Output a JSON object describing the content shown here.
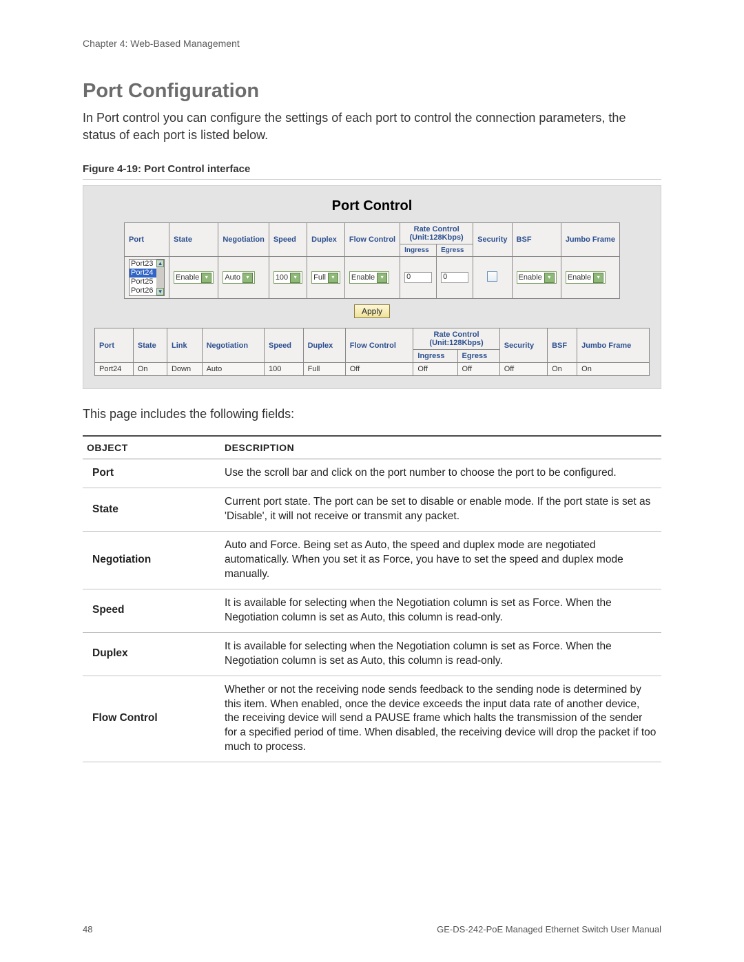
{
  "chapter_label": "Chapter 4: Web-Based Management",
  "section_title": "Port Configuration",
  "section_intro": "In Port control you can configure the settings of each port to control the connection parameters, the status of each port is listed below.",
  "figure_caption": "Figure 4-19:  Port Control interface",
  "panel": {
    "title": "Port Control",
    "control_headers": {
      "port": "Port",
      "state": "State",
      "negotiation": "Negotiation",
      "speed": "Speed",
      "duplex": "Duplex",
      "flow_control": "Flow Control",
      "rate_control_top": "Rate Control",
      "rate_control_unit": "(Unit:128Kbps)",
      "ingress": "Ingress",
      "egress": "Egress",
      "security": "Security",
      "bsf": "BSF",
      "jumbo": "Jumbo Frame"
    },
    "port_list": {
      "items": [
        "Port23",
        "Port24",
        "Port25",
        "Port26"
      ],
      "selected": "Port24"
    },
    "control_row": {
      "state": "Enable",
      "negotiation": "Auto",
      "speed": "100",
      "duplex": "Full",
      "flow_control": "Enable",
      "ingress": "0",
      "egress": "0",
      "security_checked": false,
      "bsf": "Enable",
      "jumbo": "Enable"
    },
    "apply_label": "Apply",
    "status_headers": {
      "port": "Port",
      "state": "State",
      "link": "Link",
      "negotiation": "Negotiation",
      "speed": "Speed",
      "duplex": "Duplex",
      "flow_control": "Flow Control",
      "rate_control_top": "Rate Control",
      "rate_control_unit": "(Unit:128Kbps)",
      "ingress": "Ingress",
      "egress": "Egress",
      "security": "Security",
      "bsf": "BSF",
      "jumbo": "Jumbo Frame"
    },
    "status_row": {
      "port": "Port24",
      "state": "On",
      "link": "Down",
      "negotiation": "Auto",
      "speed": "100",
      "duplex": "Full",
      "flow_control": "Off",
      "ingress": "Off",
      "egress": "Off",
      "security": "Off",
      "bsf": "On",
      "jumbo": "On"
    }
  },
  "post_figure_text": "This page includes the following fields:",
  "fields_table": {
    "head_object": "OBJECT",
    "head_description": "DESCRIPTION",
    "rows": [
      {
        "object": "Port",
        "description": "Use the scroll bar and click on the port number to choose the port to be configured."
      },
      {
        "object": "State",
        "description": "Current port state. The port can be set to disable or enable mode. If the port state is set as 'Disable', it will not receive or transmit any packet."
      },
      {
        "object": "Negotiation",
        "description": "Auto and Force. Being set as Auto, the speed and duplex mode are negotiated automatically. When you set it as Force, you have to set the speed and duplex mode manually."
      },
      {
        "object": "Speed",
        "description": "It is available for selecting when the Negotiation column is set as Force. When the Negotiation column is set as Auto, this column is read-only."
      },
      {
        "object": "Duplex",
        "description": "It is available for selecting when the Negotiation column is set as Force. When the Negotiation column is set as Auto, this column is read-only."
      },
      {
        "object": "Flow Control",
        "description": "Whether or not the receiving node sends feedback to the sending node is determined by this item. When enabled, once the device exceeds the input data rate of another device, the receiving device will send a PAUSE frame which halts the transmission of the sender for a specified period of time. When disabled, the receiving device will drop the packet if too much to process."
      }
    ]
  },
  "footer": {
    "page": "48",
    "doc": "GE-DS-242-PoE Managed Ethernet Switch User Manual"
  }
}
